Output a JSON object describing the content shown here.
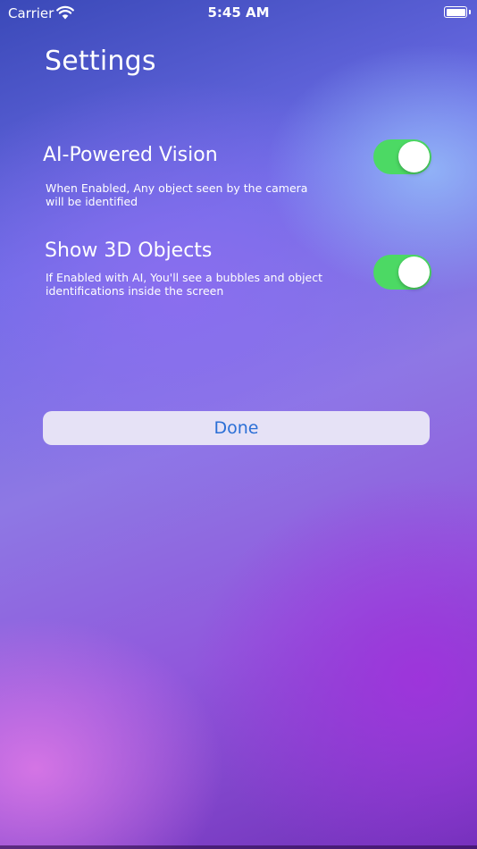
{
  "status_bar": {
    "carrier": "Carrier",
    "time": "5:45 AM",
    "wifi_icon": "wifi-icon",
    "battery_icon": "battery-icon"
  },
  "header": {
    "title": "Settings"
  },
  "settings": [
    {
      "title": "AI-Powered Vision",
      "description": "When Enabled, Any object seen by the camera will be identified",
      "enabled": true
    },
    {
      "title": "Show 3D Objects",
      "description": "If Enabled with AI, You'll see a bubbles and  object identifications inside the screen",
      "enabled": true
    }
  ],
  "done_button": {
    "label": "Done"
  },
  "colors": {
    "toggle_on": "#4cd964",
    "button_text": "#2b6fd6",
    "button_background": "#e6e2f6"
  }
}
